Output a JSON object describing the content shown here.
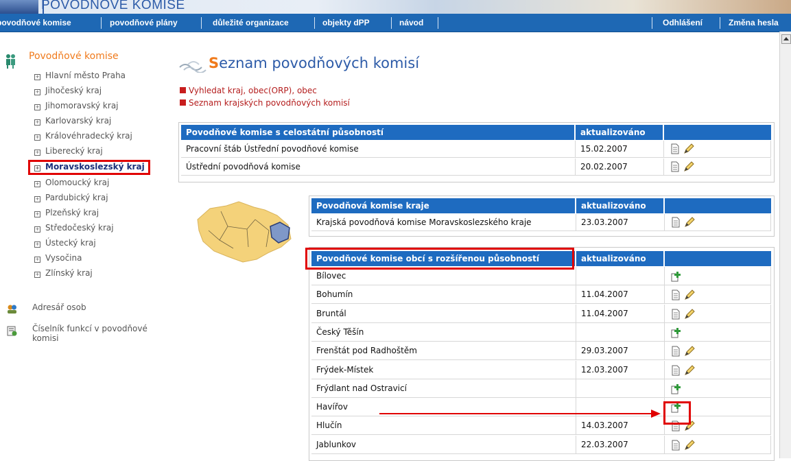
{
  "app": {
    "title": "POVODŇOVÉ KOMISE"
  },
  "nav": {
    "items": [
      "povodňové komise",
      "povodňové plány",
      "důležité organizace",
      "objekty dPP",
      "návod"
    ],
    "logout": "Odhlášení",
    "change_password": "Změna hesla"
  },
  "sidebar": {
    "title": "Povodňové komise",
    "regions": [
      "Hlavní město Praha",
      "Jihočeský kraj",
      "Jihomoravský kraj",
      "Karlovarský kraj",
      "Královéhradecký kraj",
      "Liberecký kraj",
      "Moravskoslezský kraj",
      "Olomoucký kraj",
      "Pardubický kraj",
      "Plzeňský kraj",
      "Středočeský kraj",
      "Ústecký kraj",
      "Vysočina",
      "Zlínský kraj"
    ],
    "selected_region": "Moravskoslezský kraj",
    "links": {
      "address_book": "Adresář osob",
      "function_list": "Číselník funkcí v povodňové komisi"
    }
  },
  "main": {
    "title_first": "S",
    "title_rest": "eznam povodňových komisí",
    "actions": [
      "Vyhledat kraj, obec(ORP), obec",
      "Seznam krajských povodňových komisí"
    ],
    "national": {
      "header": "Povodňové komise s celostátní působností",
      "updated_header": "aktualizováno",
      "rows": [
        {
          "name": "Pracovní štáb Ústřední povodňové komise",
          "date": "15.02.2007"
        },
        {
          "name": "Ústřední povodňová komise",
          "date": "20.02.2007"
        }
      ]
    },
    "regional": {
      "header": "Povodňová komise kraje",
      "updated_header": "aktualizováno",
      "rows": [
        {
          "name": "Krajská povodňová komise Moravskoslezského kraje",
          "date": "23.03.2007"
        }
      ]
    },
    "municipal": {
      "header": "Povodňové komise obcí s rozšířenou působností",
      "updated_header": "aktualizováno",
      "rows": [
        {
          "name": "Bílovec",
          "date": "",
          "action": "add"
        },
        {
          "name": "Bohumín",
          "date": "11.04.2007",
          "action": "view-edit"
        },
        {
          "name": "Bruntál",
          "date": "11.04.2007",
          "action": "view-edit"
        },
        {
          "name": "Český Těšín",
          "date": "",
          "action": "add"
        },
        {
          "name": "Frenštát pod Radhoštěm",
          "date": "29.03.2007",
          "action": "view-edit"
        },
        {
          "name": "Frýdek-Místek",
          "date": "12.03.2007",
          "action": "view-edit"
        },
        {
          "name": "Frýdlant nad Ostravicí",
          "date": "",
          "action": "add"
        },
        {
          "name": "Havířov",
          "date": "",
          "action": "add"
        },
        {
          "name": "Hlučín",
          "date": "14.03.2007",
          "action": "view-edit"
        },
        {
          "name": "Jablunkov",
          "date": "22.03.2007",
          "action": "view-edit"
        }
      ]
    }
  },
  "colors": {
    "nav_blue": "#1e68b4",
    "header_blue": "#1e6bc0",
    "accent_orange": "#f07a1b",
    "highlight_red": "#e00000"
  }
}
